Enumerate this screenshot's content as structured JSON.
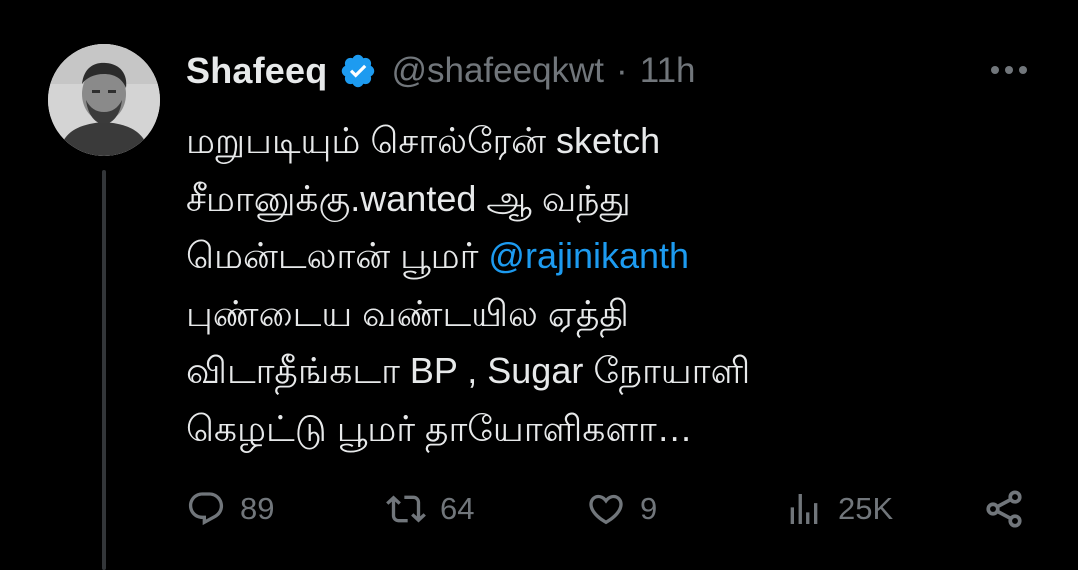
{
  "tweet": {
    "author": {
      "name": "Shafeeq",
      "handle": "@shafeeqkwt",
      "separator": "·",
      "time": "11h",
      "verified": true
    },
    "text_lines": [
      "மறுபடியும் சொல்ரேன் sketch",
      "சீமானுக்கு.wanted ஆ வந்து",
      "மென்டலான் பூமர்",
      "புண்டைய வண்டயில ஏத்தி",
      "விடாதீங்கடா BP , Sugar நோயாளி",
      "கெழட்டு பூமர் தாயோளிகளா…"
    ],
    "mention": "@rajinikanth",
    "actions": {
      "replies": "89",
      "retweets": "64",
      "likes": "9",
      "views": "25K"
    }
  },
  "icons": {
    "verified": "verified-badge-icon",
    "more": "more-options-icon",
    "reply": "reply-icon",
    "retweet": "retweet-icon",
    "like": "heart-icon",
    "views": "views-icon",
    "share": "share-icon"
  },
  "colors": {
    "background": "#000000",
    "text": "#e7e9ea",
    "muted": "#71767b",
    "accent": "#1d9bf0"
  }
}
